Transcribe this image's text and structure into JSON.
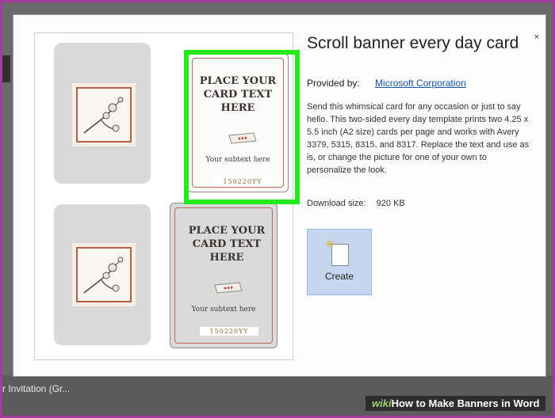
{
  "dialog": {
    "title": "Scroll banner every day card",
    "provided_label": "Provided by:",
    "provider": "Microsoft Corporation",
    "description": "Send this whimsical card for any occasion or just to say hello. This two-sided every day template prints two 4.25 x 5.5 inch (A2 size) cards per page and works with Avery 3379, 5315, 8315, and 8317. Replace the text and use as is, or change the picture for one of your own to personalize the look.",
    "download_label": "Download size:",
    "download_size": "920 KB",
    "create_label": "Create",
    "close_glyph": "×"
  },
  "cards": [
    {
      "title": "PLACE YOUR CARD TEXT HERE",
      "subtext": "Your subtext here",
      "code": "150220YY"
    },
    {
      "title": "PLACE YOUR CARD TEXT HERE",
      "subtext": "Your subtext here",
      "code": "150220YY"
    }
  ],
  "background": {
    "partial_text": "r Invitation (Gr..."
  },
  "watermark": {
    "brand": "wiki",
    "text": "How to Make Banners in Word"
  },
  "colors": {
    "highlight": "#23ea1c",
    "link": "#1a54a4",
    "create_bg": "#c4d7ee",
    "frame": "#a23c9c"
  }
}
